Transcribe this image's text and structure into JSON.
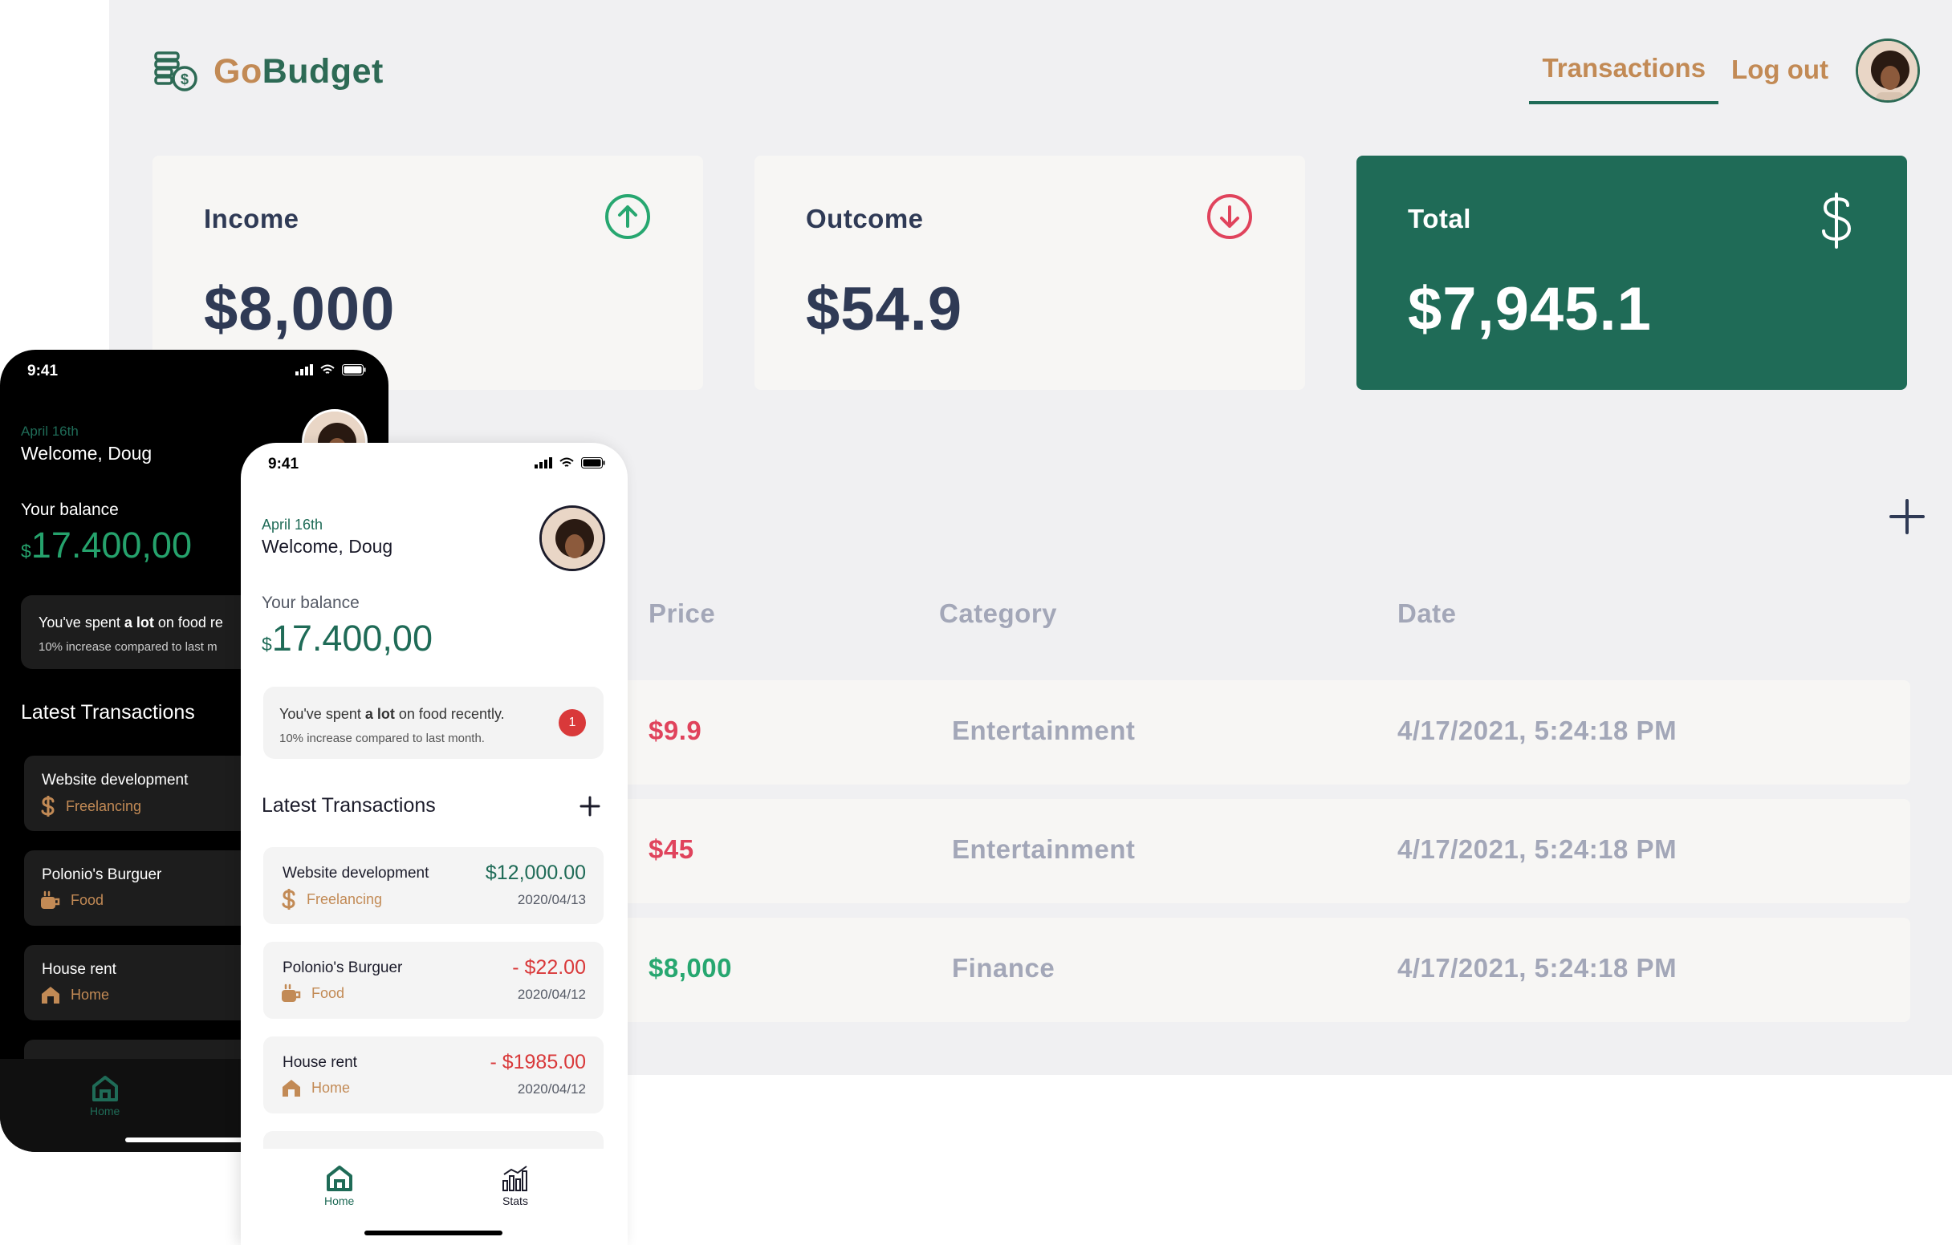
{
  "desktop": {
    "logo": {
      "prefix": "Go",
      "suffix": "Budget"
    },
    "nav": {
      "transactions": "Transactions",
      "logout": "Log out"
    },
    "cards": {
      "income": {
        "label": "Income",
        "value": "$8,000"
      },
      "outcome": {
        "label": "Outcome",
        "value": "$54.9"
      },
      "total": {
        "label": "Total",
        "value": "$7,945.1"
      }
    },
    "table": {
      "headers": {
        "price": "Price",
        "category": "Category",
        "date": "Date"
      },
      "rows": [
        {
          "price": "$9.9",
          "category": "Entertainment",
          "date": "4/17/2021, 5:24:18 PM"
        },
        {
          "price": "$45",
          "category": "Entertainment",
          "date": "4/17/2021, 5:24:18 PM"
        },
        {
          "price": "$8,000",
          "category": "Finance",
          "date": "4/17/2021, 5:24:18 PM"
        }
      ]
    },
    "colors": {
      "brand": "#1f6b57",
      "accent": "#c28a55",
      "negative": "#e0435c",
      "positive": "#27a770"
    }
  },
  "phone_dark": {
    "time": "9:41",
    "date": "April 16th",
    "welcome": "Welcome, Doug",
    "balance_label": "Your balance",
    "currency": "$",
    "balance": "17.400,00",
    "alert": {
      "prefix": "You've spent ",
      "bold": "a lot",
      "suffix": " on food re",
      "sub": "10% increase compared to last m"
    },
    "latest_title": "Latest Transactions",
    "transactions": [
      {
        "name": "Website development",
        "category": "Freelancing"
      },
      {
        "name": "Polonio's Burguer",
        "category": "Food"
      },
      {
        "name": "House rent",
        "category": "Home"
      }
    ],
    "nav": {
      "home": "Home"
    }
  },
  "phone_light": {
    "time": "9:41",
    "date": "April 16th",
    "welcome": "Welcome, Doug",
    "balance_label": "Your balance",
    "currency": "$",
    "balance": "17.400,00",
    "alert": {
      "prefix": "You've spent ",
      "bold": "a lot",
      "suffix": " on food recently.",
      "sub": "10% increase compared to last month.",
      "badge": "1"
    },
    "latest_title": "Latest Transactions",
    "transactions": [
      {
        "name": "Website development",
        "category": "Freelancing",
        "amount": "$12,000.00",
        "date": "2020/04/13"
      },
      {
        "name": "Polonio's Burguer",
        "category": "Food",
        "amount": "- $22.00",
        "date": "2020/04/12"
      },
      {
        "name": "House rent",
        "category": "Home",
        "amount": "- $1985.00",
        "date": "2020/04/12"
      }
    ],
    "nav": {
      "home": "Home",
      "stats": "Stats"
    }
  }
}
